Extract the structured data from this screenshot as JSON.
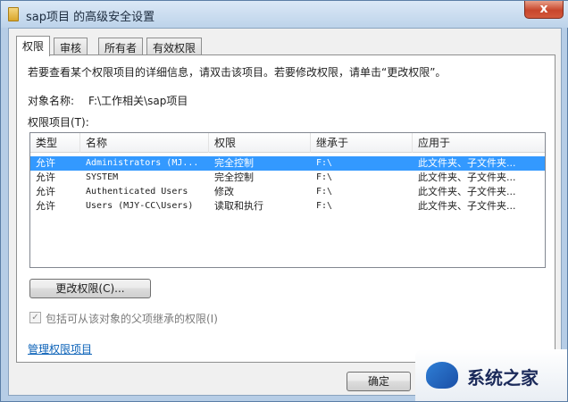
{
  "window": {
    "title": "sap项目 的高级安全设置",
    "close_glyph": "x"
  },
  "tabs": [
    {
      "label": "权限",
      "active": true
    },
    {
      "label": "审核",
      "active": false
    },
    {
      "label": "所有者",
      "active": false
    },
    {
      "label": "有效权限",
      "active": false
    }
  ],
  "panel": {
    "info_text": "若要查看某个权限项目的详细信息，请双击该项目。若要修改权限，请单击“更改权限”。",
    "object_label": "对象名称:",
    "object_value": "F:\\工作相关\\sap项目",
    "entries_label": "权限项目(T):"
  },
  "list": {
    "columns": [
      "类型",
      "名称",
      "权限",
      "继承于",
      "应用于"
    ],
    "rows": [
      {
        "type": "允许",
        "name": "Administrators (MJ...",
        "permission": "完全控制",
        "inherited": "F:\\",
        "applies": "此文件夹、子文件夹...",
        "selected": true
      },
      {
        "type": "允许",
        "name": "SYSTEM",
        "permission": "完全控制",
        "inherited": "F:\\",
        "applies": "此文件夹、子文件夹...",
        "selected": false
      },
      {
        "type": "允许",
        "name": "Authenticated Users",
        "permission": "修改",
        "inherited": "F:\\",
        "applies": "此文件夹、子文件夹...",
        "selected": false
      },
      {
        "type": "允许",
        "name": "Users (MJY-CC\\Users)",
        "permission": "读取和执行",
        "inherited": "F:\\",
        "applies": "此文件夹、子文件夹...",
        "selected": false
      }
    ]
  },
  "buttons": {
    "change_permissions": "更改权限(C)...",
    "ok": "确定"
  },
  "inherit_checkbox": {
    "label": "包括可从该对象的父项继承的权限(I)",
    "checked": true,
    "mark": "✓"
  },
  "manage_link": "管理权限项目",
  "watermark": {
    "text": "系统之家"
  }
}
